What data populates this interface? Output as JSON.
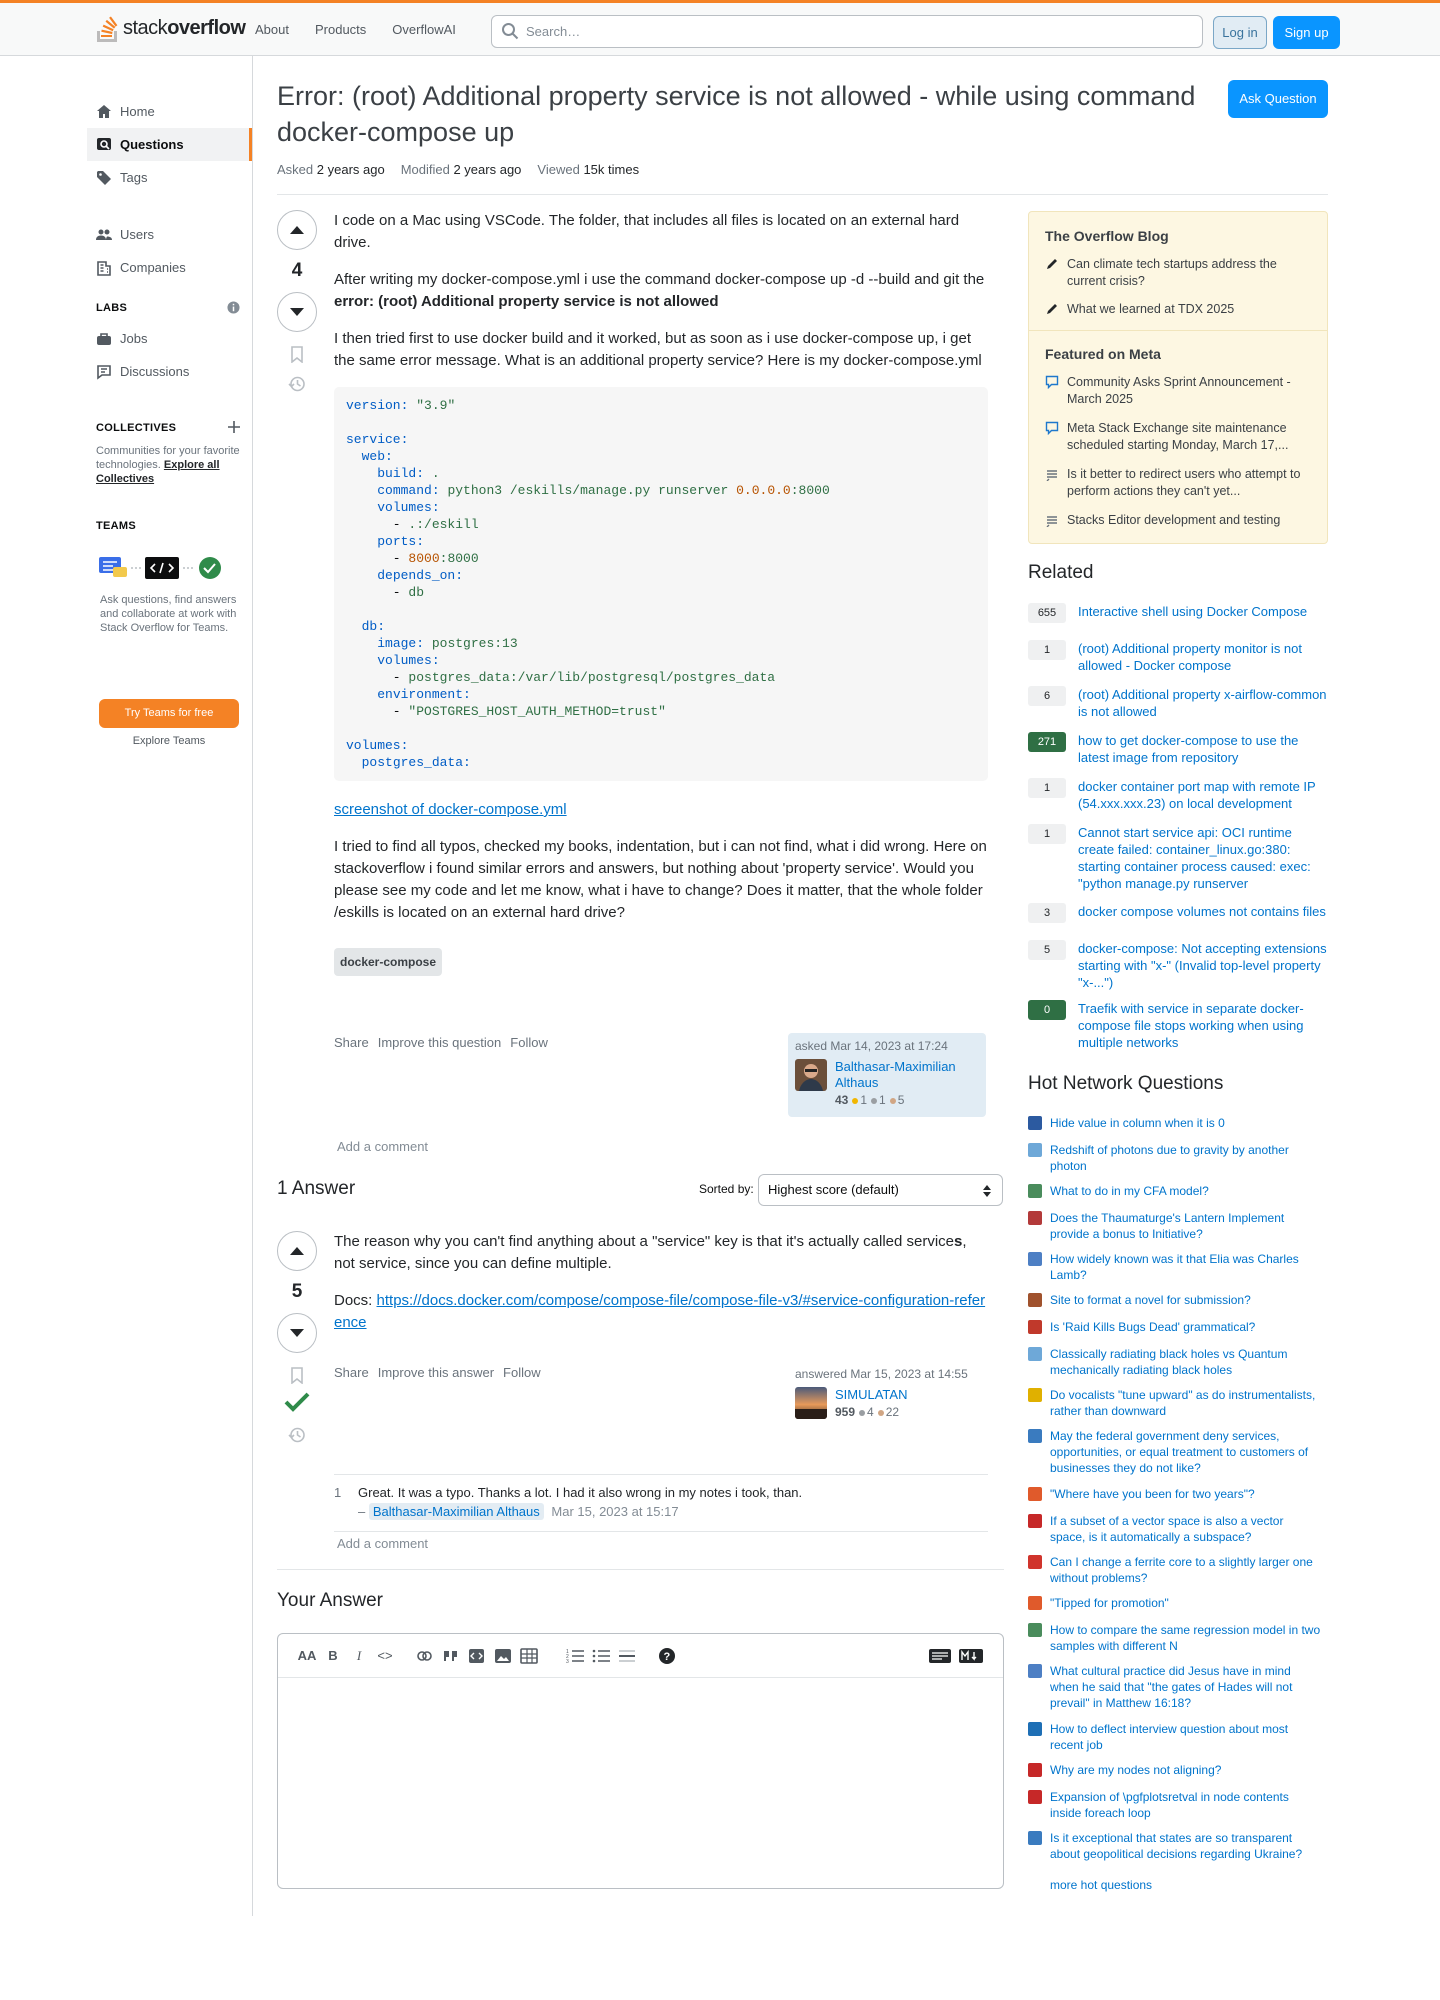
{
  "header": {
    "logo_word_light": "stack",
    "logo_word_bold": "overflow",
    "nav": [
      "About",
      "Products",
      "OverflowAI"
    ],
    "search_placeholder": "Search…",
    "login": "Log in",
    "signup": "Sign up"
  },
  "leftnav": {
    "items": [
      {
        "label": "Home",
        "icon": "home-icon"
      },
      {
        "label": "Questions",
        "icon": "questions-icon"
      },
      {
        "label": "Tags",
        "icon": "tag-icon"
      },
      {
        "label": "Users",
        "icon": "users-icon"
      },
      {
        "label": "Companies",
        "icon": "companies-icon"
      }
    ],
    "labs_heading": "LABS",
    "labs_items": [
      {
        "label": "Jobs",
        "icon": "briefcase-icon"
      },
      {
        "label": "Discussions",
        "icon": "discussions-icon"
      }
    ],
    "collectives_heading": "COLLECTIVES",
    "collectives_text": "Communities for your favorite technologies.",
    "collectives_link": "Explore all Collectives",
    "teams_heading": "TEAMS",
    "teams_text": "Ask questions, find answers and collaborate at work with Stack Overflow for Teams.",
    "teams_button": "Try Teams for free",
    "explore_teams": "Explore Teams"
  },
  "question": {
    "title": "Error: (root) Additional property service is not allowed - while using command docker-compose up",
    "ask_button": "Ask Question",
    "asked_label": "Asked",
    "asked_value": "2 years ago",
    "modified_label": "Modified",
    "modified_value": "2 years ago",
    "viewed_label": "Viewed",
    "viewed_value": "15k times",
    "score": "4",
    "p1": "I code on a Mac using VSCode. The folder, that includes all files is located on an external hard drive.",
    "p2_text": "After writing my docker-compose.yml i use the command docker-compose up -d --build and git the",
    "p2_bold": "error: (root) Additional property service is not allowed",
    "p3": "I then tried first to use docker build and it worked, but as soon as i use docker-compose up, i get the same error message. What is an additional property service? Here is my docker-compose.yml",
    "screenshot_link": "screenshot of docker-compose.yml",
    "p4": "I tried to find all typos, checked my books, indentation, but i can not find, what i did wrong. Here on stackoverflow i found similar errors and answers, but nothing about 'property service'. Would you please see my code and let me know, what i have to change? Does it matter, that the whole folder /eskills is located on an external hard drive?",
    "tag": "docker-compose",
    "menu": [
      "Share",
      "Improve this question",
      "Follow"
    ],
    "asked_on": "asked Mar 14, 2023 at 17:24",
    "user_name": "Balthasar-Maximilian Althaus",
    "user_rep": "43",
    "user_gold": "1",
    "user_silver": "1",
    "user_bronze": "5",
    "add_comment": "Add a comment"
  },
  "code_lines": {
    "version": "\"3.9\"",
    "build": ".",
    "command": "python3 /eskills/manage.py runserver",
    "command_addr": "0.0.0.0",
    "command_port": ":8000",
    "volume": ".:/eskill",
    "ports_host": "8000",
    "ports_rest": ":8000",
    "depends": "db",
    "image": "postgres:13",
    "db_volume": "postgres_data:/var/lib/postgresql/postgres_data",
    "env": "\"POSTGRES_HOST_AUTH_METHOD=trust\""
  },
  "answers": {
    "heading": "1 Answer",
    "sorted_by": "Sorted by:",
    "sort_value": "Highest score (default)",
    "score": "5",
    "p1_a": "The reason why you can't find anything about a \"service\" key is that it's actually called service",
    "p1_b": "s",
    "p1_c": ", not service, since you can define multiple.",
    "docs_label": "Docs:",
    "docs_link": "https://docs.docker.com/compose/compose-file/compose-file-v3/#service-configuration-reference",
    "menu": [
      "Share",
      "Improve this answer",
      "Follow"
    ],
    "answered_on": "answered Mar 15, 2023 at 14:55",
    "user_name": "SIMULATAN",
    "user_rep": "959",
    "user_silver": "4",
    "user_bronze": "22",
    "comment_score": "1",
    "comment_text": "Great. It was a typo. Thanks a lot. I had it also wrong in my notes i took, than.",
    "comment_dash": "–",
    "comment_user": "Balthasar-Maximilian Althaus",
    "comment_date": "Mar 15, 2023 at 15:17",
    "add_comment": "Add a comment"
  },
  "your_answer": {
    "heading": "Your Answer",
    "toolbar": [
      "AA",
      "B",
      "I",
      "<>",
      "link",
      "quote",
      "snippet",
      "image",
      "table",
      "ol",
      "ul",
      "hr",
      "?"
    ]
  },
  "sidebar": {
    "blog_heading": "The Overflow Blog",
    "blog_items": [
      "Can climate tech startups address the current crisis?",
      "What we learned at TDX 2025"
    ],
    "meta_heading": "Featured on Meta",
    "meta_items": [
      "Community Asks Sprint Announcement - March 2025",
      "Meta Stack Exchange site maintenance scheduled starting Monday, March 17,...",
      "Is it better to redirect users who attempt to perform actions they can't yet...",
      "Stacks Editor development and testing"
    ],
    "related_heading": "Related",
    "related": [
      {
        "score": "655",
        "accepted": false,
        "title": "Interactive shell using Docker Compose"
      },
      {
        "score": "1",
        "accepted": false,
        "title": "(root) Additional property monitor is not allowed - Docker compose"
      },
      {
        "score": "6",
        "accepted": false,
        "title": "(root) Additional property x-airflow-common is not allowed"
      },
      {
        "score": "271",
        "accepted": true,
        "title": "how to get docker-compose to use the latest image from repository"
      },
      {
        "score": "1",
        "accepted": false,
        "title": "docker container port map with remote IP (54.xxx.xxx.23) on local development"
      },
      {
        "score": "1",
        "accepted": false,
        "title": "Cannot start service api: OCI runtime create failed: container_linux.go:380: starting container process caused: exec: \"python manage.py runserver"
      },
      {
        "score": "3",
        "accepted": false,
        "title": "docker compose volumes not contains files"
      },
      {
        "score": "5",
        "accepted": false,
        "title": "docker-compose: Not accepting extensions starting with \"x-\" (Invalid top-level property \"x-...\")"
      },
      {
        "score": "0",
        "accepted": true,
        "title": "Traefik with service in separate docker-compose file stops working when using multiple networks"
      }
    ],
    "hnq_heading": "Hot Network Questions",
    "hnq": [
      {
        "title": "Hide value in column when it is 0",
        "color": "#2c5aa0"
      },
      {
        "title": "Redshift of photons due to gravity by another photon",
        "color": "#6ea8d8"
      },
      {
        "title": "What to do in my CFA model?",
        "color": "#4a8c5c"
      },
      {
        "title": "Does the Thaumaturge's Lantern Implement provide a bonus to Initiative?",
        "color": "#b33a3a"
      },
      {
        "title": "How widely known was it that Elia was Charles Lamb?",
        "color": "#4d7fc4"
      },
      {
        "title": "Site to format a novel for submission?",
        "color": "#a0522d"
      },
      {
        "title": "Is 'Raid Kills Bugs Dead' grammatical?",
        "color": "#c0392b"
      },
      {
        "title": "Classically radiating black holes vs Quantum mechanically radiating black holes",
        "color": "#6ea8d8"
      },
      {
        "title": "Do vocalists \"tune upward\" as do instrumentalists, rather than downward",
        "color": "#e0b000"
      },
      {
        "title": "May the federal government deny services, opportunities, or equal treatment to customers of businesses they do not like?",
        "color": "#3a7bbf"
      },
      {
        "title": "\"Where have you been for two years\"?",
        "color": "#e05a2b"
      },
      {
        "title": "If a subset of a vector space is also a vector space, is it automatically a subspace?",
        "color": "#c62828"
      },
      {
        "title": "Can I change a ferrite core to a slightly larger one without problems?",
        "color": "#d0342c"
      },
      {
        "title": "\"Tipped for promotion\"",
        "color": "#e05a2b"
      },
      {
        "title": "How to compare the same regression model in two samples with different N",
        "color": "#4a8c5c"
      },
      {
        "title": "What cultural practice did Jesus have in mind when he said that \"the gates of Hades will not prevail\" in Matthew 16:18?",
        "color": "#4d7fc4"
      },
      {
        "title": "How to deflect interview question about most recent job",
        "color": "#1e6fb5"
      },
      {
        "title": "Why are my nodes not aligning?",
        "color": "#c62828"
      },
      {
        "title": "Expansion of \\pgfplotsretval in node contents inside foreach loop",
        "color": "#c62828"
      },
      {
        "title": "Is it exceptional that states are so transparent about geopolitical decisions regarding Ukraine?",
        "color": "#3a7bbf"
      }
    ],
    "more_hot": "more hot questions"
  },
  "colors": {
    "accent_orange": "#f48225",
    "primary_blue": "#0a95ff",
    "accepted_green": "#2f6f44"
  }
}
